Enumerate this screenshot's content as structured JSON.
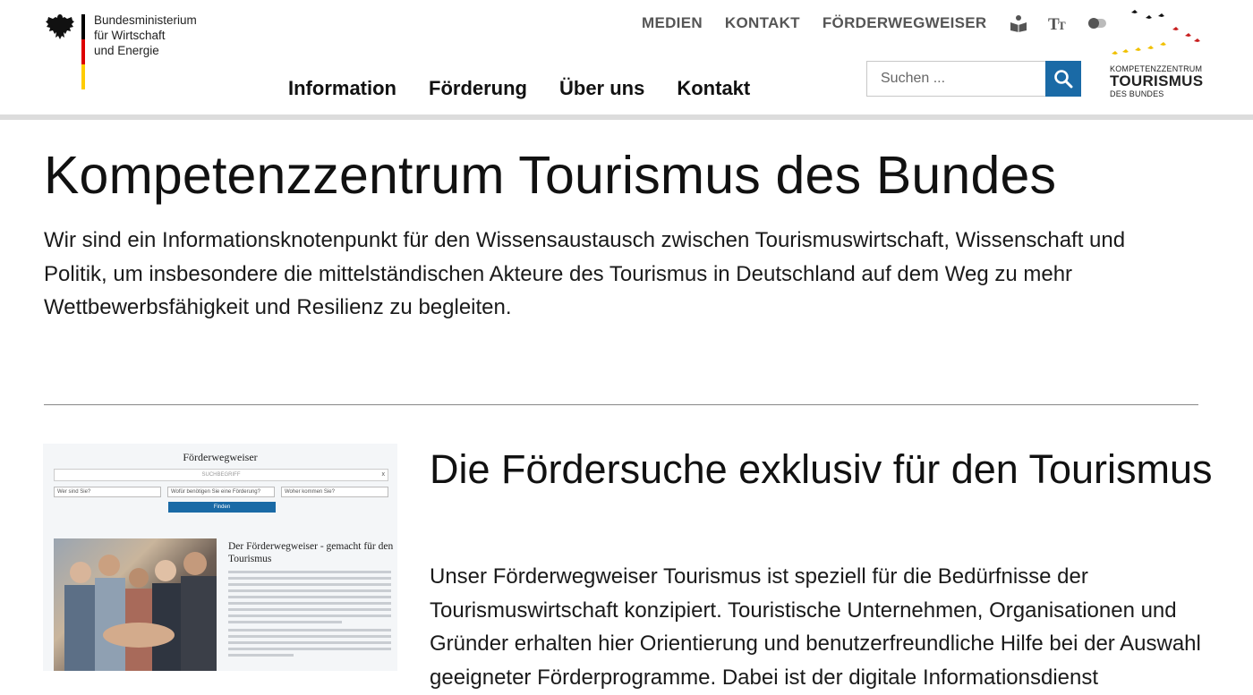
{
  "header": {
    "ministry_logo": {
      "lines": [
        "Bundesministerium",
        "für Wirtschaft",
        "und Energie"
      ]
    },
    "meta_nav": [
      {
        "label": "MEDIEN"
      },
      {
        "label": "KONTAKT"
      },
      {
        "label": "FÖRDERWEGWEISER"
      }
    ],
    "meta_icons": [
      "book-reader-icon",
      "text-size-icon",
      "contrast-toggle-icon"
    ],
    "main_nav": [
      {
        "label": "Information"
      },
      {
        "label": "Förderung"
      },
      {
        "label": "Über uns"
      },
      {
        "label": "Kontakt"
      }
    ],
    "search": {
      "placeholder": "Suchen ...",
      "icon": "search-icon"
    },
    "ktb_logo": {
      "line1": "KOMPETENZZENTRUM",
      "line2": "TOURISMUS",
      "line3": "DES BUNDES"
    }
  },
  "main": {
    "title": "Kompetenzzentrum Tourismus des Bundes",
    "intro": "Wir sind ein Informationsknotenpunkt für den Wissensaustausch zwischen Tourismuswirtschaft, Wissenschaft und Politik, um insbesondere die mittelständischen Akteure des Tourismus in Deutschland auf dem Weg zu mehr Wettbewerbsfähigkeit und Resilienz zu begleiten.",
    "teaser": {
      "image": {
        "title": "Förderwegweiser",
        "search_placeholder": "SUCHBEGRIFF",
        "clear": "x",
        "selects": [
          "Wer sind Sie?",
          "Wofür benötigen Sie eine Förderung?",
          "Woher kommen Sie?"
        ],
        "button": "Finden",
        "card_title": "Der Förderwegweiser - gemacht für den Tourismus"
      },
      "title": "Die Fördersuche exklusiv für den Tourismus",
      "body": "Unser Förderwegweiser Tourismus ist speziell für die Bedürfnisse der Tourismuswirtschaft konzipiert. Touristische Unternehmen, Organisationen und Gründer erhalten hier Orientierung und benutzerfreundliche Hilfe bei der Auswahl geeigneter Förderprogramme. Dabei ist der digitale Informationsdienst"
    }
  },
  "colors": {
    "accent_blue": "#1a6aa6",
    "flag_black": "#000000",
    "flag_red": "#dd0000",
    "flag_gold": "#ffcc00",
    "header_rule": "#dcdcdc"
  }
}
